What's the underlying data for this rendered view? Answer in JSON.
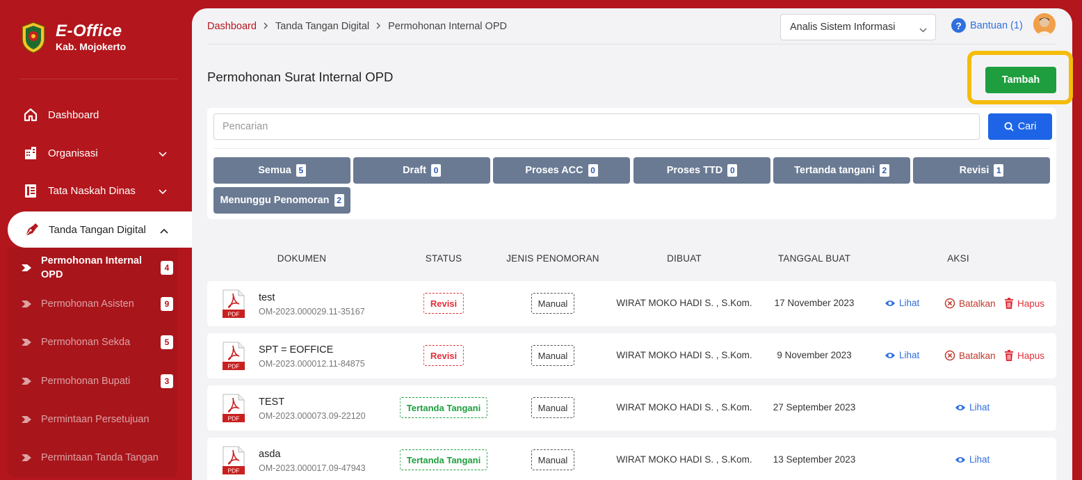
{
  "brand": {
    "title": "E-Office",
    "subtitle": "Kab. Mojokerto"
  },
  "sidebar": {
    "items": [
      {
        "label": "Dashboard",
        "icon": "home-icon"
      },
      {
        "label": "Organisasi",
        "icon": "building-icon"
      },
      {
        "label": "Tata Naskah Dinas",
        "icon": "document-icon"
      },
      {
        "label": "Tanda Tangan Digital",
        "icon": "pen-nib-icon"
      }
    ],
    "subitems": [
      {
        "label": "Permohonan Internal OPD",
        "badge": "4"
      },
      {
        "label": "Permohonan Asisten",
        "badge": "9"
      },
      {
        "label": "Permohonan Sekda",
        "badge": "5"
      },
      {
        "label": "Permohonan Bupati",
        "badge": "3"
      },
      {
        "label": "Permintaan Persetujuan"
      },
      {
        "label": "Permintaan Tanda Tangan"
      }
    ]
  },
  "breadcrumb": [
    "Dashboard",
    "Tanda Tangan Digital",
    "Permohonan Internal OPD"
  ],
  "header": {
    "role": "Analis Sistem Informasi",
    "help": "Bantuan (1)"
  },
  "page": {
    "title": "Permohonan Surat Internal OPD",
    "add_label": "Tambah"
  },
  "search": {
    "placeholder": "Pencarian",
    "button": "Cari"
  },
  "filters": [
    {
      "label": "Semua",
      "count": "5"
    },
    {
      "label": "Draft",
      "count": "0"
    },
    {
      "label": "Proses ACC",
      "count": "0"
    },
    {
      "label": "Proses TTD",
      "count": "0"
    },
    {
      "label": "Tertanda tangani",
      "count": "2"
    },
    {
      "label": "Revisi",
      "count": "1"
    },
    {
      "label": "Menunggu Penomoran",
      "count": "2"
    }
  ],
  "table": {
    "columns": [
      "DOKUMEN",
      "STATUS",
      "JENIS PENOMORAN",
      "DIBUAT",
      "TANGGAL BUAT",
      "AKSI"
    ],
    "pdf_label": "PDF",
    "actions": {
      "view": "Lihat",
      "cancel": "Batalkan",
      "delete": "Hapus"
    },
    "rows": [
      {
        "title": "test",
        "number": "OM-2023.000029.11-35167",
        "status": "Revisi",
        "jenis": "Manual",
        "dibuat": "WIRAT MOKO HADI S. , S.Kom.",
        "tanggal": "17 November 2023"
      },
      {
        "title": "SPT = EOFFICE",
        "number": "OM-2023.000012.11-84875",
        "status": "Revisi",
        "jenis": "Manual",
        "dibuat": "WIRAT MOKO HADI S. , S.Kom.",
        "tanggal": "9 November 2023"
      },
      {
        "title": "TEST",
        "number": "OM-2023.000073.09-22120",
        "status": "Tertanda Tangani",
        "jenis": "Manual",
        "dibuat": "WIRAT MOKO HADI S. , S.Kom.",
        "tanggal": "27 September 2023"
      },
      {
        "title": "asda",
        "number": "OM-2023.000017.09-47943",
        "status": "Tertanda Tangani",
        "jenis": "Manual",
        "dibuat": "WIRAT MOKO HADI S. , S.Kom.",
        "tanggal": "13 September 2023"
      }
    ]
  },
  "colors": {
    "brand_red": "#b3161c",
    "success": "#1e9e3e",
    "primary": "#1e64e6",
    "highlight": "#f5bc0a",
    "chip": "#6a7a93"
  }
}
